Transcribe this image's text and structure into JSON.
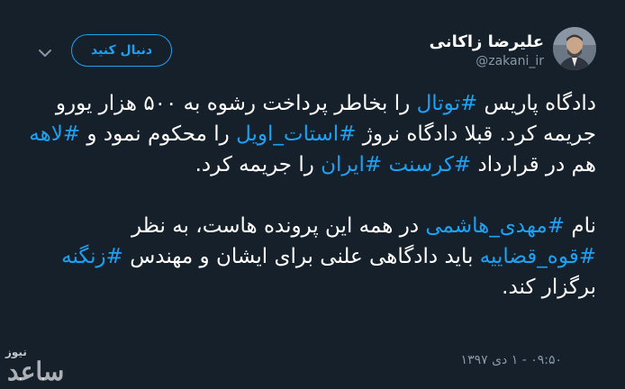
{
  "author": {
    "display_name": "علیرضا زاکانی",
    "handle": "@zakani_ir"
  },
  "follow_button": {
    "label": "دنبال کنید"
  },
  "icons": {
    "more": "chevron-down-icon",
    "avatar": "profile-photo"
  },
  "colors": {
    "background": "#15202b",
    "accent": "#1da1f2",
    "text": "#ffffff",
    "muted": "#8899a6"
  },
  "tweet": {
    "p1": {
      "t1": "دادگاه پاریس ",
      "h1": "#توتال",
      "t2": " را بخاطر پرداخت رشوه به ۵۰۰ هزار یورو جریمه کرد. قبلا دادگاه نروژ ",
      "h2": "#استات_اویل",
      "t3": " را محکوم  نمود و ",
      "h3": "#لاهه",
      "t4": " هم در قرارداد ",
      "h4": "#کرسنت",
      "t5": " ",
      "h5": "#ایران",
      "t6": " را جریمه کرد."
    },
    "p2": {
      "t1": "نام ",
      "h1": "#مهدی_هاشمی",
      "t2": " در همه این پرونده هاست، به نظر ",
      "h2": "#قوه_قضاییه",
      "t3": " باید دادگاهی علنی برای ایشان و مهندس ",
      "h3": "#زنگنه",
      "t4": " برگزار کند."
    }
  },
  "timestamp": "۰۹:۵۰ - ۱ دی ۱۳۹۷",
  "watermark": {
    "small": "نیوز",
    "big": "ساعد"
  }
}
